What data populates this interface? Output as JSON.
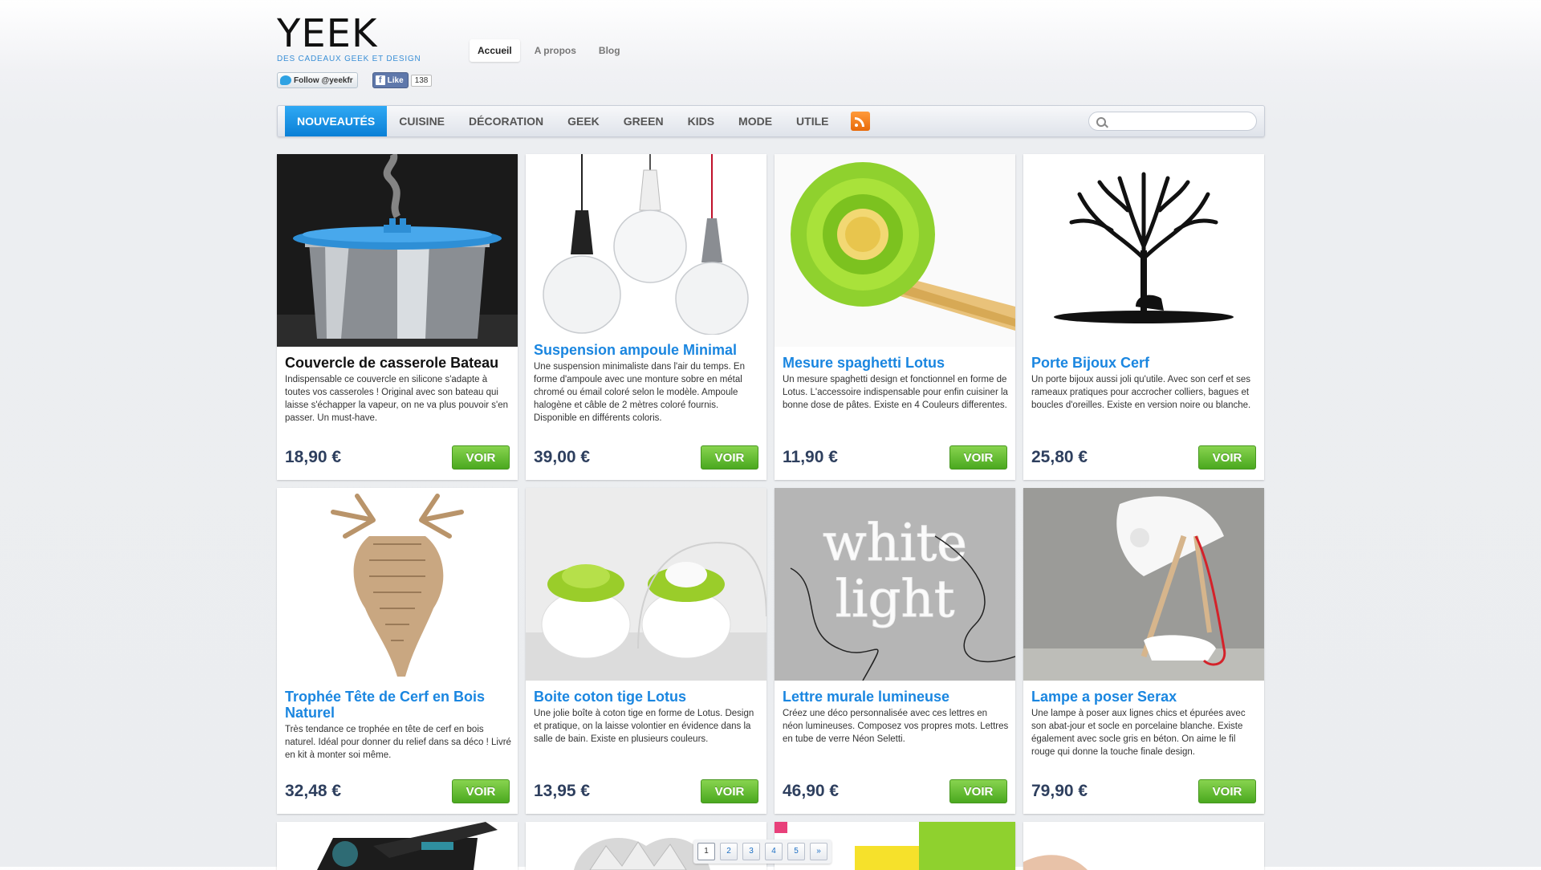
{
  "site": {
    "logo": "YEEK",
    "tagline": "DES CADEAUX GEEK ET DESIGN"
  },
  "topnav": [
    {
      "label": "Accueil",
      "active": true
    },
    {
      "label": "A propos"
    },
    {
      "label": "Blog"
    }
  ],
  "social": {
    "twitter_label": "Follow @yeekfr",
    "fb_label": "Like",
    "fb_count": "138"
  },
  "categories": [
    {
      "label": "NOUVEAUTÉS",
      "active": true
    },
    {
      "label": "CUISINE"
    },
    {
      "label": "DÉCORATION"
    },
    {
      "label": "GEEK"
    },
    {
      "label": "GREEN"
    },
    {
      "label": "KIDS"
    },
    {
      "label": "MODE"
    },
    {
      "label": "UTILE"
    }
  ],
  "search": {
    "placeholder": ""
  },
  "products": [
    {
      "title": "Couvercle de casserole Bateau",
      "desc": "Indispensable ce couvercle en silicone s'adapte à toutes vos casseroles ! Original avec son bateau qui laisse s'échapper la vapeur, on ne va plus pouvoir s'en passer. Un must-have.",
      "price": "18,90 €",
      "cta": "VOIR"
    },
    {
      "title": "Suspension ampoule Minimal",
      "desc": "Une suspension minimaliste dans l'air du temps. En forme d'ampoule avec une monture sobre en métal chromé ou émail coloré selon le modèle. Ampoule halogène et câble de 2 mètres coloré fournis. Disponible en différents coloris.",
      "price": "39,00 €",
      "cta": "VOIR"
    },
    {
      "title": "Mesure spaghetti Lotus",
      "desc": "Un mesure spaghetti design et fonctionnel en forme de Lotus. L'accessoire indispensable pour enfin cuisiner la bonne dose de pâtes. Existe en 4 Couleurs differentes.",
      "price": "11,90 €",
      "cta": "VOIR"
    },
    {
      "title": "Porte Bijoux Cerf",
      "desc": "Un porte bijoux aussi joli qu'utile. Avec son cerf et ses rameaux pratiques pour accrocher colliers, bagues et boucles d'oreilles. Existe en version noire ou blanche.",
      "price": "25,80 €",
      "cta": "VOIR"
    },
    {
      "title": "Trophée Tête de Cerf en Bois Naturel",
      "desc": "Très tendance ce trophée en tête de cerf en bois naturel. Idéal pour donner du relief dans sa déco ! Livré en kit à monter soi même.",
      "price": "32,48 €",
      "cta": "VOIR"
    },
    {
      "title": "Boite coton tige Lotus",
      "desc": "Une jolie boîte à coton tige en forme de Lotus. Design et pratique, on la laisse volontier en évidence dans la salle de bain. Existe en plusieurs couleurs.",
      "price": "13,95 €",
      "cta": "VOIR"
    },
    {
      "title": "Lettre murale lumineuse",
      "desc": "Créez une déco personnalisée avec ces lettres en néon lumineuses. Composez vos propres mots. Lettres en tube de verre Néon Seletti.",
      "price": "46,90 €",
      "cta": "VOIR"
    },
    {
      "title": "Lampe a poser Serax",
      "desc": "Une lampe à poser aux lignes chics et épurées avec son abat-jour et socle en porcelaine blanche. Existe également avec socle gris en béton. On aime le fil rouge qui donne la touche finale design.",
      "price": "79,90 €",
      "cta": "VOIR"
    }
  ],
  "neon_text": [
    "white",
    "light"
  ],
  "pagination": [
    "1",
    "2",
    "3",
    "4",
    "5",
    "»"
  ],
  "colors": {
    "accent": "#1a86e0",
    "active_cat": "#0a7fd6",
    "button_green": "#5cb82a",
    "price": "#2e3f5e"
  }
}
